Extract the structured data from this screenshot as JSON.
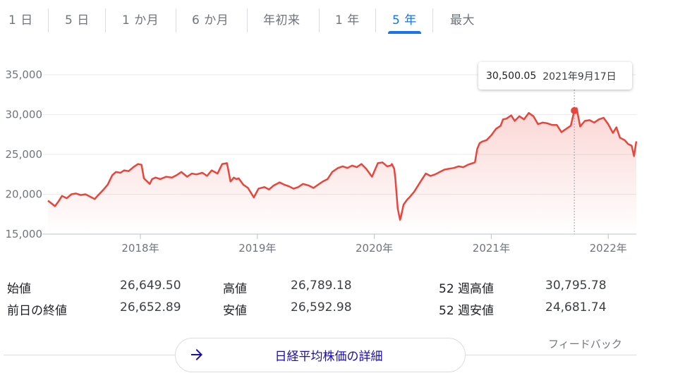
{
  "tabs": [
    {
      "label": "1 日"
    },
    {
      "label": "5 日"
    },
    {
      "label": "1 か月"
    },
    {
      "label": "6 か月"
    },
    {
      "label": "年初来"
    },
    {
      "label": "1 年"
    },
    {
      "label": "5 年"
    },
    {
      "label": "最大"
    }
  ],
  "active_tab": "5 年",
  "tooltip": {
    "value": "30,500.05",
    "date": "2021年9月17日"
  },
  "stats": {
    "open_label": "始値",
    "open_value": "26,649.50",
    "high_label": "高値",
    "high_value": "26,789.18",
    "w52high_label": "52 週高値",
    "w52high_value": "30,795.78",
    "prevclose_label": "前日の終値",
    "prevclose_value": "26,652.89",
    "low_label": "安値",
    "low_value": "26,592.98",
    "w52low_label": "52 週安値",
    "w52low_value": "24,681.74"
  },
  "feedback_label": "フィードバック",
  "details_button_label": "日経平均株価の詳細",
  "icons": {
    "details_arrow": "arrow-right-icon"
  },
  "colors": {
    "line": "#e8453c",
    "accent": "#1a73e8",
    "link": "#1a0dab"
  },
  "chart_data": {
    "type": "area",
    "y_ticks": [
      "35,000",
      "30,000",
      "25,000",
      "20,000",
      "15,000"
    ],
    "x_ticks": [
      "2018年",
      "2019年",
      "2020年",
      "2021年",
      "2022年"
    ],
    "ylim": [
      15000,
      35000
    ],
    "xlim": [
      2017.21,
      2022.24
    ],
    "grid": true,
    "tick_positions": [
      2018.0,
      2019.0,
      2020.0,
      2021.0,
      2022.0
    ],
    "highlight": {
      "x": 2021.71,
      "y": 30500.05
    },
    "series": [
      {
        "x": [
          2017.21,
          2017.27,
          2017.3,
          2017.33,
          2017.37,
          2017.41,
          2017.45,
          2017.49,
          2017.53,
          2017.57,
          2017.61,
          2017.64,
          2017.68,
          2017.72,
          2017.76,
          2017.79,
          2017.83,
          2017.86,
          2017.9,
          2017.94,
          2017.98,
          2018.01,
          2018.03,
          2018.08,
          2018.1,
          2018.13,
          2018.17,
          2018.22,
          2018.27,
          2018.31,
          2018.35,
          2018.4,
          2018.44,
          2018.48,
          2018.53,
          2018.57,
          2018.61,
          2018.66,
          2018.7,
          2018.74,
          2018.75,
          2018.77,
          2018.8,
          2018.82,
          2018.84,
          2018.88,
          2018.92,
          2018.97,
          2019.01,
          2019.06,
          2019.1,
          2019.14,
          2019.19,
          2019.23,
          2019.27,
          2019.31,
          2019.35,
          2019.39,
          2019.44,
          2019.48,
          2019.52,
          2019.56,
          2019.6,
          2019.64,
          2019.69,
          2019.73,
          2019.77,
          2019.81,
          2019.85,
          2019.89,
          2019.93,
          2019.98,
          2020.03,
          2020.07,
          2020.11,
          2020.14,
          2020.15,
          2020.17,
          2020.18,
          2020.2,
          2020.22,
          2020.23,
          2020.25,
          2020.28,
          2020.3,
          2020.34,
          2020.4,
          2020.44,
          2020.48,
          2020.52,
          2020.56,
          2020.6,
          2020.64,
          2020.68,
          2020.72,
          2020.76,
          2020.8,
          2020.84,
          2020.86,
          2020.88,
          2020.9,
          2020.92,
          2020.96,
          2021.0,
          2021.04,
          2021.08,
          2021.1,
          2021.13,
          2021.17,
          2021.2,
          2021.24,
          2021.28,
          2021.32,
          2021.36,
          2021.4,
          2021.44,
          2021.48,
          2021.52,
          2021.56,
          2021.6,
          2021.64,
          2021.68,
          2021.71,
          2021.73,
          2021.76,
          2021.8,
          2021.84,
          2021.88,
          2021.92,
          2021.96,
          2022.0,
          2022.04,
          2022.07,
          2022.1,
          2022.14,
          2022.17,
          2022.2,
          2022.22,
          2022.24
        ],
        "y": [
          19200,
          18500,
          19100,
          19800,
          19500,
          20000,
          20100,
          19900,
          20000,
          19700,
          19400,
          19900,
          20500,
          21200,
          22400,
          22800,
          22700,
          23000,
          22900,
          23400,
          23800,
          23700,
          22000,
          21300,
          21900,
          22100,
          21900,
          22200,
          22100,
          22400,
          22800,
          22200,
          22600,
          22500,
          22700,
          22300,
          23000,
          22600,
          23800,
          23900,
          23200,
          21600,
          22100,
          21900,
          22000,
          21200,
          20800,
          19600,
          20700,
          20900,
          20600,
          21100,
          21500,
          21200,
          21000,
          20700,
          20900,
          21300,
          21100,
          20800,
          21200,
          21600,
          21900,
          22800,
          23300,
          23500,
          23300,
          23600,
          23400,
          23800,
          23200,
          22200,
          23900,
          24000,
          23500,
          23600,
          23800,
          23200,
          22000,
          18200,
          16800,
          17300,
          18700,
          19300,
          19600,
          20300,
          21700,
          22600,
          22300,
          22500,
          22800,
          23100,
          23200,
          23300,
          23500,
          23400,
          23700,
          23900,
          24000,
          25700,
          26400,
          26600,
          26800,
          27400,
          28200,
          28600,
          29400,
          29500,
          29900,
          29200,
          29800,
          29400,
          30200,
          29800,
          28800,
          29000,
          28900,
          28700,
          28700,
          27800,
          28200,
          28600,
          30500,
          30800,
          28500,
          29200,
          29300,
          29000,
          29400,
          29600,
          28800,
          27700,
          28400,
          27100,
          26800,
          26300,
          26100,
          24800,
          26650
        ]
      }
    ]
  }
}
